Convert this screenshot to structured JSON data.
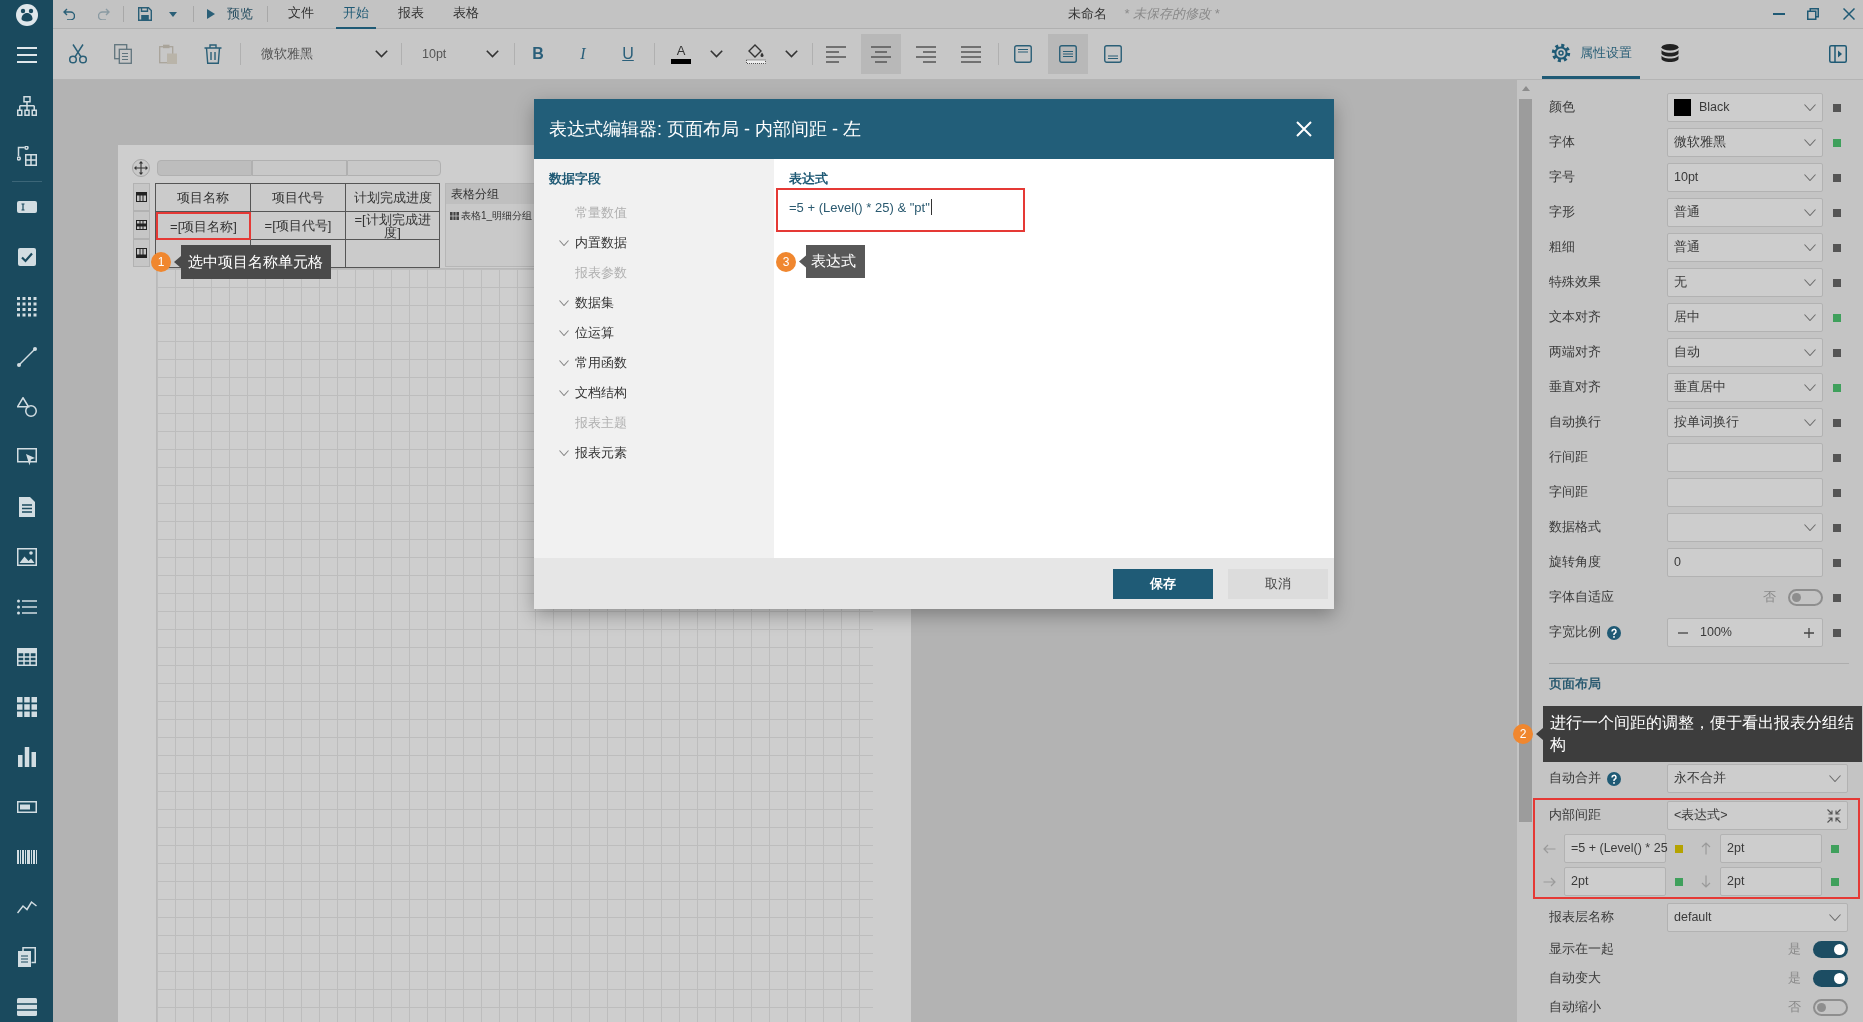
{
  "title_bar": {
    "preview": "预览",
    "menu_tabs": [
      {
        "label": "文件",
        "selected": false
      },
      {
        "label": "开始",
        "selected": true
      },
      {
        "label": "报表",
        "selected": false
      },
      {
        "label": "表格",
        "selected": false
      }
    ],
    "document_name": "未命名",
    "unsaved_note": "* 未保存的修改 *"
  },
  "toolbar": {
    "font_family": "微软雅黑",
    "font_size": "10pt",
    "style_buttons": [
      {
        "kind": "bold",
        "label": "B"
      },
      {
        "kind": "italic",
        "label": "I"
      },
      {
        "kind": "underline",
        "label": "U"
      }
    ],
    "font_color": "A",
    "text_align": [
      {
        "kind": "left",
        "selected": false
      },
      {
        "kind": "center",
        "selected": true
      },
      {
        "kind": "right",
        "selected": false
      },
      {
        "kind": "justify",
        "selected": false
      }
    ],
    "vertical_align": [
      {
        "kind": "top",
        "selected": false
      },
      {
        "kind": "middle",
        "selected": true
      },
      {
        "kind": "bottom",
        "selected": false
      }
    ],
    "panel_tabs": [
      {
        "kind": "properties",
        "label": "属性设置",
        "selected": true
      },
      {
        "kind": "data",
        "selected": false
      }
    ]
  },
  "canvas": {
    "table": {
      "rows": [
        {
          "kind": "header",
          "cells": [
            "项目名称",
            "项目代号",
            "计划完成进度"
          ]
        },
        {
          "kind": "detail",
          "cells": [
            "=[项目名称]",
            "=[项目代号]",
            "=[计划完成进度]"
          ]
        },
        {
          "kind": "footer"
        }
      ]
    },
    "group_panel": {
      "title": "表格分组",
      "items": [
        "表格1_明细分组"
      ]
    },
    "annotation": {
      "number": "1",
      "text": "选中项目名称单元格",
      "highlight": true
    }
  },
  "dialog": {
    "title": "表达式编辑器: 页面布局 - 内部间距 - 左",
    "fields_heading": "数据字段",
    "tree": [
      {
        "label": "常量数值",
        "disabled": true
      },
      {
        "label": "内置数据",
        "disabled": false
      },
      {
        "label": "报表参数",
        "disabled": true
      },
      {
        "label": "数据集",
        "disabled": false
      },
      {
        "label": "位运算",
        "disabled": false
      },
      {
        "label": "常用函数",
        "disabled": false
      },
      {
        "label": "文档结构",
        "disabled": false
      },
      {
        "label": "报表主题",
        "disabled": true
      },
      {
        "label": "报表元素",
        "disabled": false
      }
    ],
    "expression_label": "表达式",
    "expression": "=5 + (Level() * 25) & \"pt\"",
    "annotation": {
      "number": "3",
      "text": "表达式",
      "highlight": true
    },
    "buttons": [
      {
        "kind": "primary",
        "label": "保存"
      },
      {
        "kind": "secondary",
        "label": "取消"
      }
    ]
  },
  "properties": {
    "rows": [
      {
        "label": "颜色",
        "kind": "dropdown",
        "value": "Black",
        "swatch": {
          "color": "#000000"
        },
        "help": false,
        "marker": {
          "color": "#555555"
        }
      },
      {
        "label": "字体",
        "kind": "dropdown",
        "value": "微软雅黑",
        "help": false,
        "marker": {
          "color": "#3fa05c"
        }
      },
      {
        "label": "字号",
        "kind": "dropdown",
        "value": "10pt",
        "help": false,
        "marker": {
          "color": "#555555"
        }
      },
      {
        "label": "字形",
        "kind": "dropdown",
        "value": "普通",
        "help": false,
        "marker": {
          "color": "#555555"
        }
      },
      {
        "label": "粗细",
        "kind": "dropdown",
        "value": "普通",
        "help": false,
        "marker": {
          "color": "#555555"
        }
      },
      {
        "label": "特殊效果",
        "kind": "dropdown",
        "value": "无",
        "help": false,
        "marker": {
          "color": "#555555"
        }
      },
      {
        "label": "文本对齐",
        "kind": "dropdown",
        "value": "居中",
        "help": false,
        "marker": {
          "color": "#3fa05c"
        }
      },
      {
        "label": "两端对齐",
        "kind": "dropdown",
        "value": "自动",
        "help": false,
        "marker": {
          "color": "#555555"
        }
      },
      {
        "label": "垂直对齐",
        "kind": "dropdown",
        "value": "垂直居中",
        "help": false,
        "marker": {
          "color": "#3fa05c"
        }
      },
      {
        "label": "自动换行",
        "kind": "dropdown",
        "value": "按单词换行",
        "help": false,
        "marker": {
          "color": "#555555"
        }
      },
      {
        "label": "行间距",
        "kind": "text",
        "help": false,
        "marker": {
          "color": "#555555"
        }
      },
      {
        "label": "字间距",
        "kind": "text",
        "help": false,
        "marker": {
          "color": "#555555"
        }
      },
      {
        "label": "数据格式",
        "kind": "dropdown",
        "help": false,
        "marker": {
          "color": "#555555"
        }
      },
      {
        "label": "旋转角度",
        "kind": "text",
        "value": "0",
        "help": false,
        "marker": {
          "color": "#555555"
        }
      },
      {
        "label": "字体自适应",
        "kind": "toggle",
        "state_label": "否",
        "on": false,
        "help": false,
        "marker": {
          "color": "#555555"
        }
      },
      {
        "label": "字宽比例",
        "kind": "stepper",
        "value": "100%",
        "help": true,
        "marker": {
          "color": "#555555"
        }
      }
    ],
    "page_layout": {
      "heading": "页面布局",
      "annotation": {
        "number": "2",
        "text": "进行一个间距的调整，便于看出报表分组结构",
        "highlight": true
      },
      "rows": [
        {
          "label": "自动合并",
          "kind": "dropdown",
          "value": "永不合并",
          "help": true
        },
        {
          "label": "内部间距",
          "kind": "expression",
          "value": "<表达式>",
          "help": false
        },
        {
          "kind": "padding",
          "sides": [
            {
              "kind": "left",
              "value": "=5 + (Level() * 25",
              "marker": {
                "color": "#b5a300"
              }
            },
            {
              "kind": "top",
              "value": "2pt",
              "marker": {
                "color": "#3fa05c"
              }
            },
            {
              "kind": "right",
              "value": "2pt",
              "marker": {
                "color": "#3fa05c"
              }
            },
            {
              "kind": "bottom",
              "value": "2pt",
              "marker": {
                "color": "#3fa05c"
              }
            }
          ]
        },
        {
          "label": "报表层名称",
          "kind": "dropdown",
          "value": "default",
          "help": false
        },
        {
          "label": "显示在一起",
          "kind": "toggle",
          "state_label": "是",
          "on": true,
          "help": false
        },
        {
          "label": "自动变大",
          "kind": "toggle",
          "state_label": "是",
          "on": true,
          "help": false
        },
        {
          "label": "自动缩小",
          "kind": "toggle",
          "state_label": "否",
          "on": false,
          "help": false
        }
      ]
    }
  }
}
